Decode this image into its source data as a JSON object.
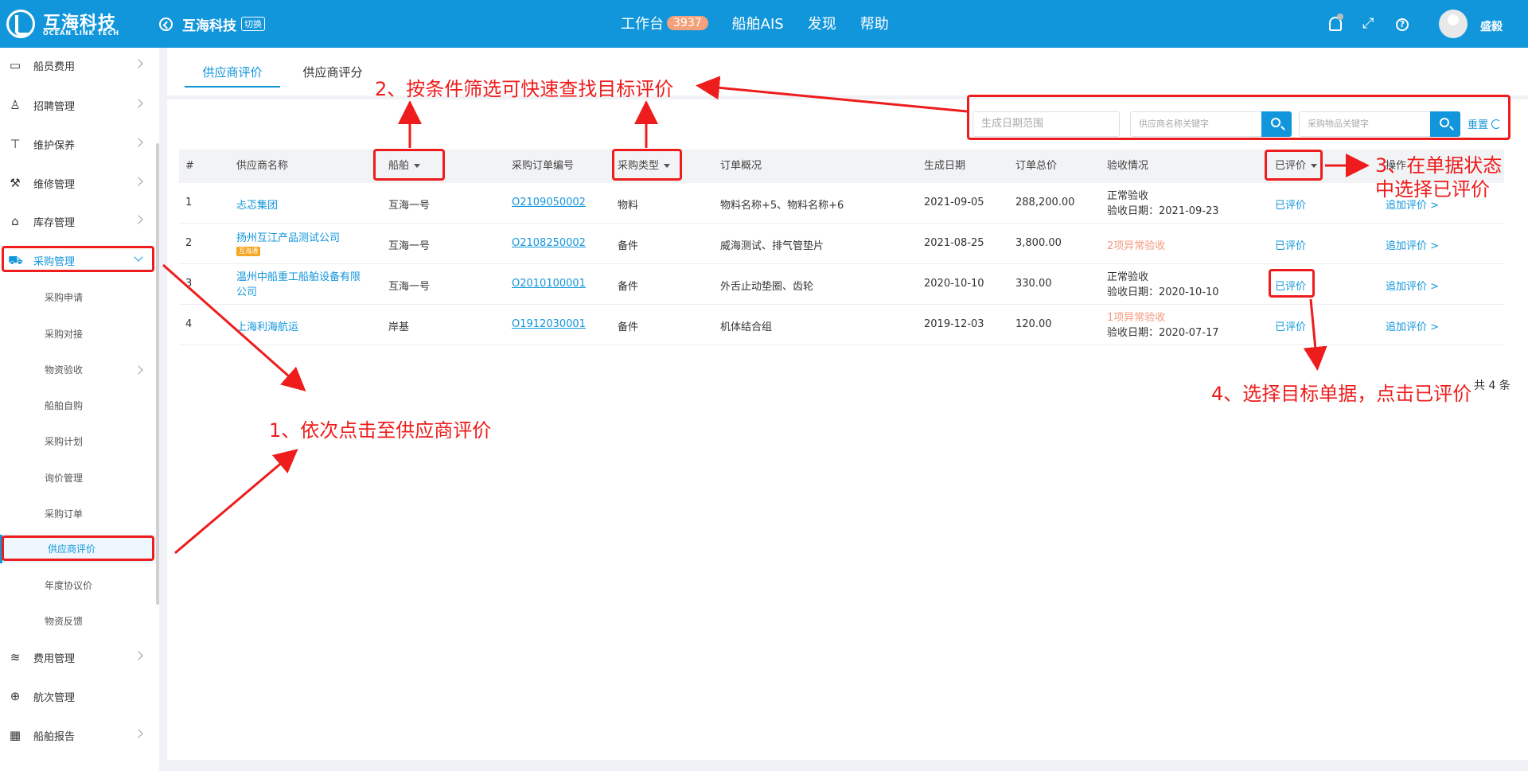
{
  "header": {
    "logo_cn": "互海科技",
    "logo_en": "OCEAN LINK TECH",
    "company": "互海科技",
    "switch_label": "切换",
    "nav": [
      {
        "label": "工作台",
        "badge": "3937"
      },
      {
        "label": "船舶AIS"
      },
      {
        "label": "发现"
      },
      {
        "label": "帮助"
      }
    ],
    "username": "盛毅"
  },
  "sidebar": {
    "items": [
      {
        "label": "船员费用",
        "icon": "wallet-icon"
      },
      {
        "label": "招聘管理",
        "icon": "user-icon"
      },
      {
        "label": "维护保养",
        "icon": "wrench-icon"
      },
      {
        "label": "维修管理",
        "icon": "tool-icon"
      },
      {
        "label": "库存管理",
        "icon": "warehouse-icon"
      },
      {
        "label": "采购管理",
        "icon": "cart-icon"
      }
    ],
    "sub_items": [
      "采购申请",
      "采购对接",
      "物资验收",
      "船舶自购",
      "采购计划",
      "询价管理",
      "采购订单",
      "供应商评价",
      "年度协议价",
      "物资反馈"
    ],
    "bottom_items": [
      {
        "label": "费用管理",
        "icon": "coins-icon"
      },
      {
        "label": "航次管理",
        "icon": "globe-icon"
      },
      {
        "label": "船舶报告",
        "icon": "calendar-icon"
      }
    ]
  },
  "tabs": [
    "供应商评价",
    "供应商评分"
  ],
  "filters": {
    "date_placeholder": "生成日期范围",
    "supplier_placeholder": "供应商名称关键字",
    "goods_placeholder": "采购物品关键字",
    "reset_label": "重置"
  },
  "table": {
    "headers": [
      "#",
      "供应商名称",
      "船舶",
      "采购订单编号",
      "采购类型",
      "订单概况",
      "生成日期",
      "订单总价",
      "验收情况",
      "已评价",
      "操作"
    ],
    "rows": [
      {
        "no": "1",
        "supplier": "忐忑集团",
        "ship": "互海一号",
        "order_no": "O2109050002",
        "type": "物料",
        "summary": "物料名称+5、物料名称+6",
        "date": "2021-09-05",
        "total": "288,200.00",
        "check_status": "正常验收",
        "check_date": "验收日期：2021-09-23",
        "status": "已评价",
        "op": "追加评价 >"
      },
      {
        "no": "2",
        "supplier": "扬州互江产品测试公司",
        "supplier_tag": "互海通",
        "ship": "互海一号",
        "order_no": "O2108250002",
        "type": "备件",
        "summary": "威海测试、排气管垫片",
        "date": "2021-08-25",
        "total": "3,800.00",
        "check_status": "2项异常验收",
        "status": "已评价",
        "op": "追加评价 >"
      },
      {
        "no": "3",
        "supplier_line1": "温州中船重工船舶设备有限",
        "supplier_line2": "公司",
        "ship": "互海一号",
        "order_no": "O2010100001",
        "type": "备件",
        "summary": "外舌止动垫圈、齿轮",
        "date": "2020-10-10",
        "total": "330.00",
        "check_status": "正常验收",
        "check_date": "验收日期：2020-10-10",
        "status": "已评价",
        "op": "追加评价 >"
      },
      {
        "no": "4",
        "supplier": "上海利海航运",
        "ship": "岸基",
        "order_no": "O1912030001",
        "type": "备件",
        "summary": "机体结合组",
        "date": "2019-12-03",
        "total": "120.00",
        "check_status": "1项异常验收",
        "check_date": "验收日期：2020-07-17",
        "status": "已评价",
        "op": "追加评价 >"
      }
    ],
    "total_text": "共 4 条"
  },
  "annotations": {
    "step1": "1、依次点击至供应商评价",
    "step2": "2、按条件筛选可快速查找目标评价",
    "step3_line1": "3、在单据状态",
    "step3_line2": "中选择已评价",
    "step4": "4、选择目标单据，点击已评价"
  },
  "colors": {
    "primary": "#1296db",
    "annotation": "#ee1c1c",
    "warning": "#f49a7e",
    "badge": "#f4a17c"
  }
}
